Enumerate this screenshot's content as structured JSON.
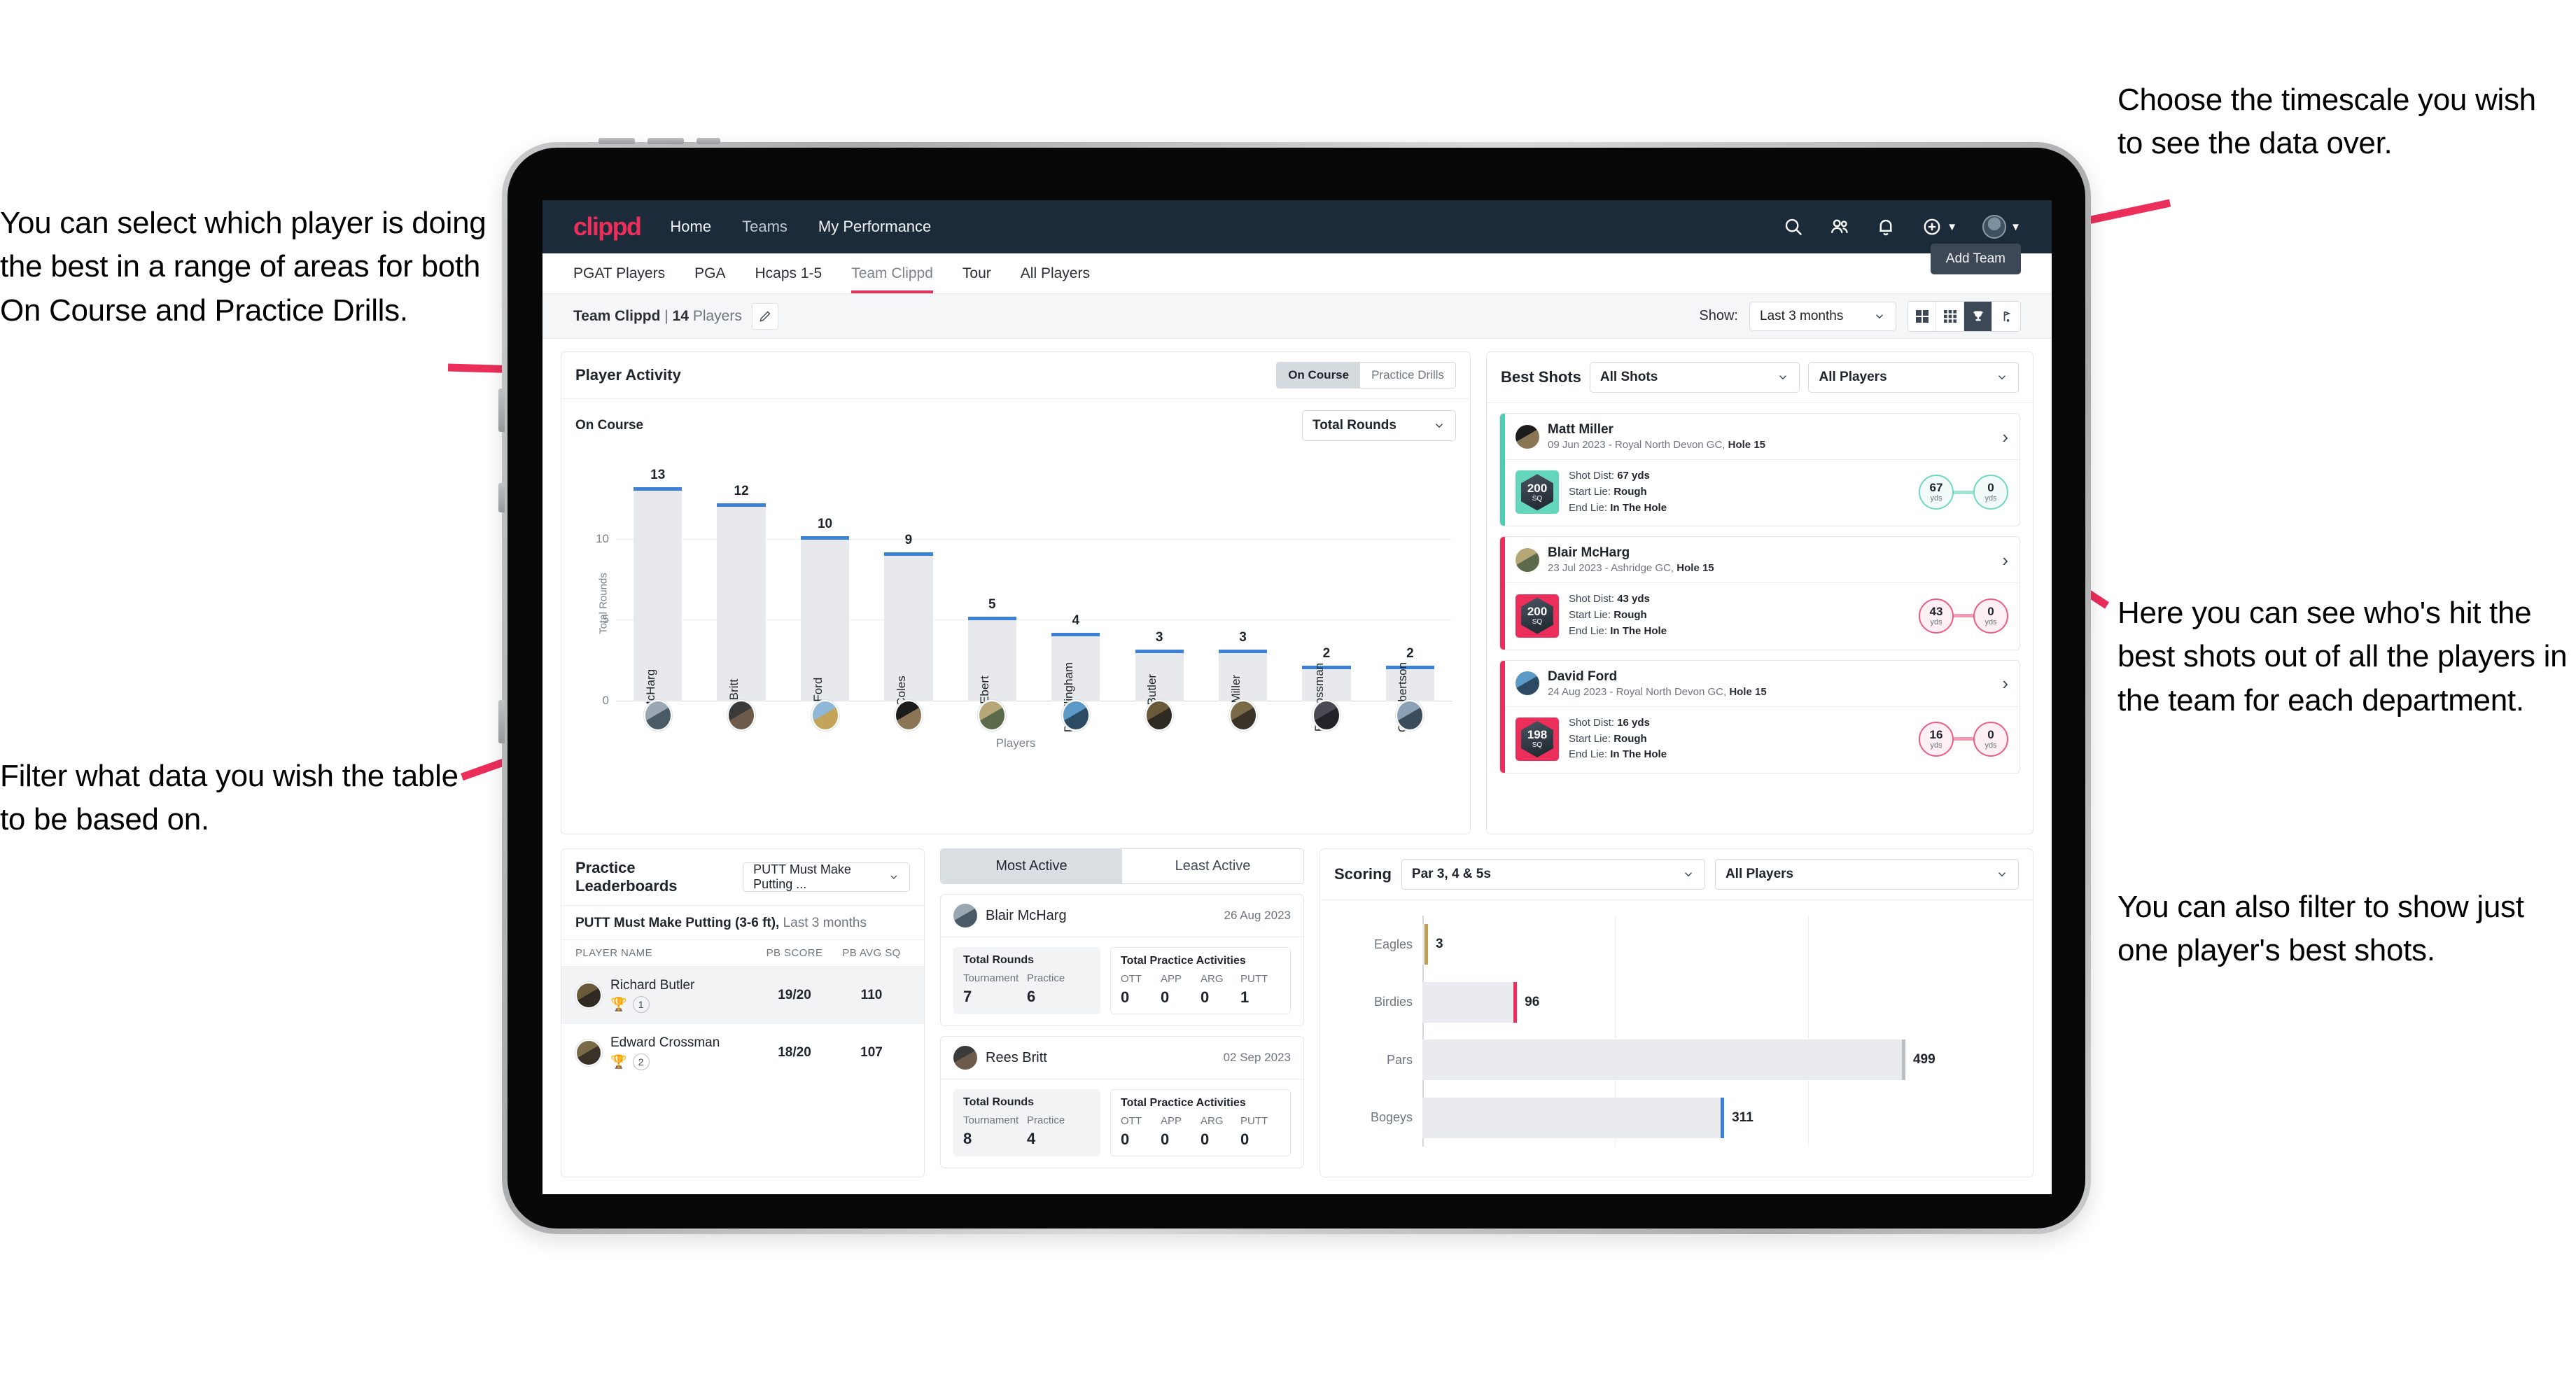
{
  "annotations": {
    "left_top": "You can select which player is doing the best in a range of areas for both On Course and Practice Drills.",
    "left_bottom": "Filter what data you wish the table to be based on.",
    "right_top": "Choose the timescale you wish to see the data over.",
    "right_mid": "Here you can see who's hit the best shots out of all the players in the team for each department.",
    "right_bottom": "You can also filter to show just one player's best shots."
  },
  "brand": {
    "name": "clippd",
    "accent": "#ec2e5b"
  },
  "topnav": {
    "links": [
      "Home",
      "Teams",
      "My Performance"
    ],
    "icons": [
      "search-icon",
      "people-icon",
      "bell-icon",
      "plus-circle-icon",
      "avatar"
    ]
  },
  "tabs": {
    "items": [
      "PGAT Players",
      "PGA",
      "Hcaps 1-5",
      "Team Clippd",
      "Tour",
      "All Players"
    ],
    "active": "Team Clippd",
    "add_team_label": "Add Team"
  },
  "subbar": {
    "team_name": "Team Clippd",
    "separator": "|",
    "player_count": "14",
    "players_word": "Players",
    "show_label": "Show:",
    "timescale_value": "Last 3 months",
    "view_buttons": [
      "grid-2x2-icon",
      "grid-3x3-icon",
      "trophy-icon",
      "golf-flag-icon"
    ],
    "active_view": "trophy-icon"
  },
  "player_activity": {
    "title": "Player Activity",
    "segments": [
      "On Course",
      "Practice Drills"
    ],
    "active_segment": "On Course",
    "sub_label": "On Course",
    "metric_select": "Total Rounds"
  },
  "chart_data": {
    "type": "bar",
    "title": "Player Activity",
    "xlabel": "Players",
    "ylabel": "Total Rounds",
    "ylim": [
      0,
      14
    ],
    "yticks": [
      0,
      5,
      10
    ],
    "grid": true,
    "categories": [
      "B. McHarg",
      "R. Britt",
      "D. Ford",
      "J. Coles",
      "E. Ebert",
      "D. Billingham",
      "R. Butler",
      "M. Miller",
      "E. Crossman",
      "C. Robertson"
    ],
    "values": [
      13,
      12,
      10,
      9,
      5,
      4,
      3,
      3,
      2,
      2
    ],
    "bar_color": "#e7e9ec",
    "cap_color": "#3b82d6"
  },
  "best_shots": {
    "title": "Best Shots",
    "shot_filter": "All Shots",
    "player_filter": "All Players",
    "cards": [
      {
        "player": "Matt Miller",
        "meta_date": "09 Jun 2023",
        "meta_course": "Royal North Devon GC,",
        "meta_hole": "Hole 15",
        "badge_value": "200",
        "badge_unit": "SQ",
        "accent": "teal",
        "shot_dist_label": "Shot Dist:",
        "shot_dist": "67 yds",
        "start_lie_label": "Start Lie:",
        "start_lie": "Rough",
        "end_lie_label": "End Lie:",
        "end_lie": "In The Hole",
        "start_node": "67",
        "start_unit": "yds",
        "end_node": "0",
        "end_unit": "yds"
      },
      {
        "player": "Blair McHarg",
        "meta_date": "23 Jul 2023",
        "meta_course": "Ashridge GC,",
        "meta_hole": "Hole 15",
        "badge_value": "200",
        "badge_unit": "SQ",
        "accent": "pink",
        "shot_dist_label": "Shot Dist:",
        "shot_dist": "43 yds",
        "start_lie_label": "Start Lie:",
        "start_lie": "Rough",
        "end_lie_label": "End Lie:",
        "end_lie": "In The Hole",
        "start_node": "43",
        "start_unit": "yds",
        "end_node": "0",
        "end_unit": "yds"
      },
      {
        "player": "David Ford",
        "meta_date": "24 Aug 2023",
        "meta_course": "Royal North Devon GC,",
        "meta_hole": "Hole 15",
        "badge_value": "198",
        "badge_unit": "SQ",
        "accent": "pink",
        "shot_dist_label": "Shot Dist:",
        "shot_dist": "16 yds",
        "start_lie_label": "Start Lie:",
        "start_lie": "Rough",
        "end_lie_label": "End Lie:",
        "end_lie": "In The Hole",
        "start_node": "16",
        "start_unit": "yds",
        "end_node": "0",
        "end_unit": "yds"
      }
    ]
  },
  "practice_leaderboards": {
    "title": "Practice Leaderboards",
    "drill_select": "PUTT Must Make Putting ...",
    "sub_title": "PUTT Must Make Putting (3-6 ft),",
    "sub_period": "Last 3 months",
    "columns": [
      "PLAYER NAME",
      "PB SCORE",
      "PB AVG SQ"
    ],
    "rows": [
      {
        "name": "Richard Butler",
        "rank": "1",
        "trophy": "gold",
        "pb_score": "19/20",
        "pb_avg_sq": "110"
      },
      {
        "name": "Edward Crossman",
        "rank": "2",
        "trophy": "silver",
        "pb_score": "18/20",
        "pb_avg_sq": "107"
      }
    ]
  },
  "activity": {
    "tabs": [
      "Most Active",
      "Least Active"
    ],
    "active_tab": "Most Active",
    "cards": [
      {
        "name": "Blair McHarg",
        "date": "26 Aug 2023",
        "rounds_title": "Total Rounds",
        "rounds_keys": [
          "Tournament",
          "Practice"
        ],
        "rounds_vals": [
          "7",
          "6"
        ],
        "practice_title": "Total Practice Activities",
        "practice_keys": [
          "OTT",
          "APP",
          "ARG",
          "PUTT"
        ],
        "practice_vals": [
          "0",
          "0",
          "0",
          "1"
        ]
      },
      {
        "name": "Rees Britt",
        "date": "02 Sep 2023",
        "rounds_title": "Total Rounds",
        "rounds_keys": [
          "Tournament",
          "Practice"
        ],
        "rounds_vals": [
          "8",
          "4"
        ],
        "practice_title": "Total Practice Activities",
        "practice_keys": [
          "OTT",
          "APP",
          "ARG",
          "PUTT"
        ],
        "practice_vals": [
          "0",
          "0",
          "0",
          "0"
        ]
      }
    ]
  },
  "scoring": {
    "title": "Scoring",
    "par_filter": "Par 3, 4 & 5s",
    "player_filter": "All Players",
    "chart": {
      "type": "bar",
      "orientation": "horizontal",
      "categories": [
        "Eagles",
        "Birdies",
        "Pars",
        "Bogeys"
      ],
      "values": [
        3,
        96,
        499,
        311
      ],
      "xlim": [
        0,
        600
      ],
      "colors": [
        "#c0a050",
        "#ec2e5b",
        "#b9bec4",
        "#3b82d6"
      ]
    }
  }
}
